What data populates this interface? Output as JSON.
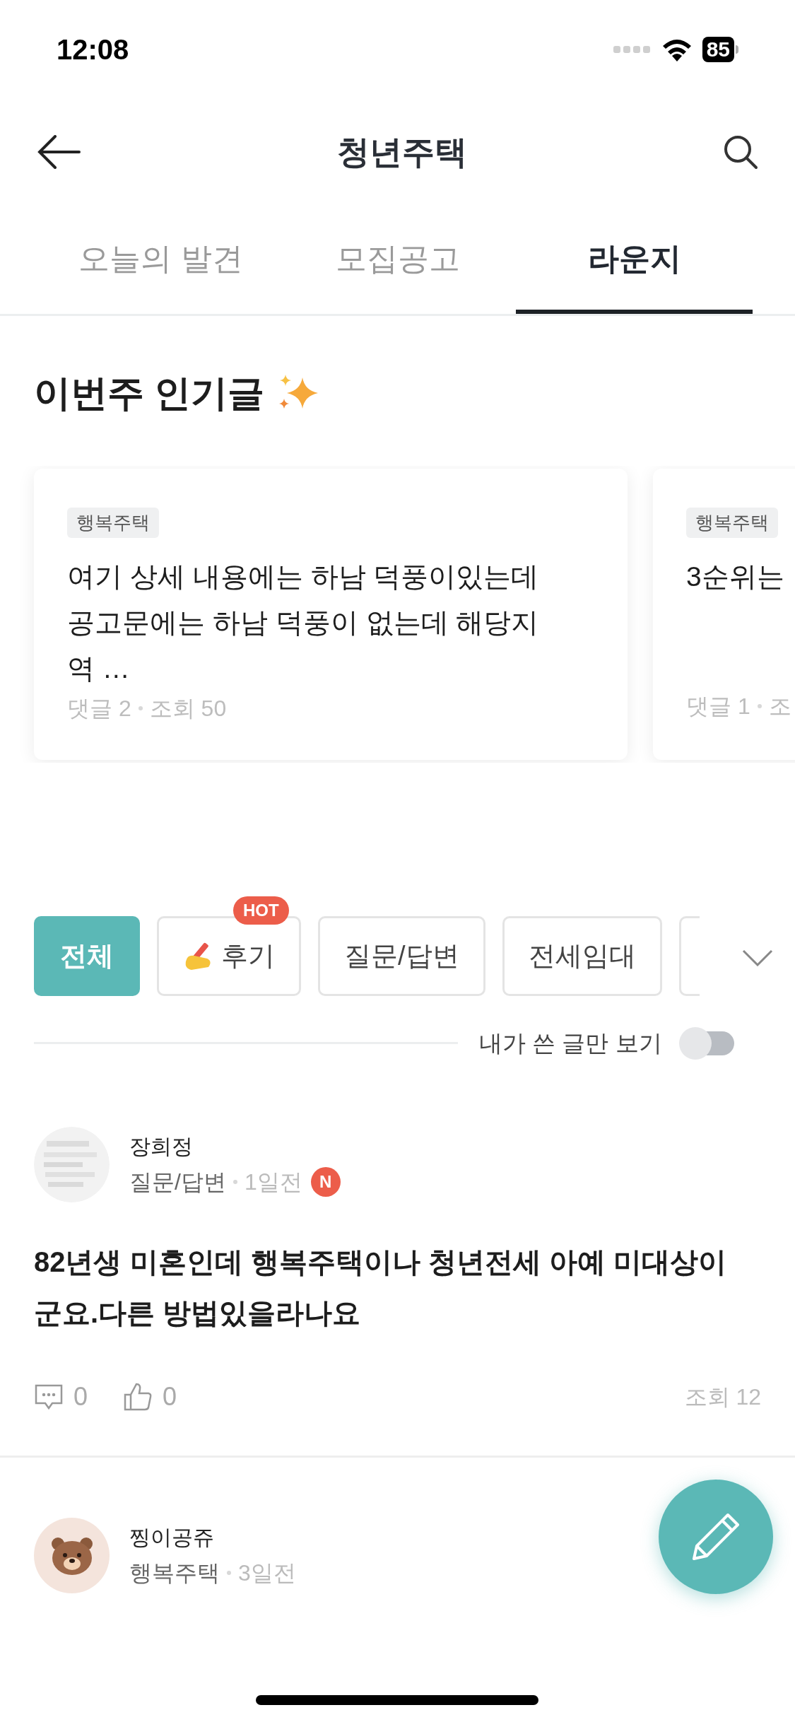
{
  "status_bar": {
    "time": "12:08",
    "battery": "85"
  },
  "header": {
    "title": "청년주택"
  },
  "tabs": [
    {
      "label": "오늘의 발견",
      "selected": false
    },
    {
      "label": "모집공고",
      "selected": false
    },
    {
      "label": "라운지",
      "selected": true
    }
  ],
  "popular": {
    "title": "이번주 인기글",
    "cards": [
      {
        "tag": "행복주택",
        "text": "여기 상세 내용에는 하남 덕풍이있는데 공고문에는 하남 덕풍이 없는데 해당지역 …",
        "comments": "댓글 2",
        "views": "조회 50"
      },
      {
        "tag": "행복주택",
        "text": "3순위는",
        "comments": "댓글 1",
        "views": "조"
      }
    ]
  },
  "categories": [
    {
      "label": "전체",
      "selected": true,
      "kind": "plain"
    },
    {
      "label": "후기",
      "selected": false,
      "kind": "emoji",
      "badge": "HOT"
    },
    {
      "label": "질문/답변",
      "selected": false,
      "kind": "plain"
    },
    {
      "label": "전세임대",
      "selected": false,
      "kind": "plain"
    },
    {
      "selected": false,
      "kind": "cut"
    }
  ],
  "my_posts_toggle": {
    "label": "내가 쓴 글만 보기",
    "on": false
  },
  "posts": [
    {
      "author": "장희정",
      "category": "질문/답변",
      "time": "1일전",
      "new_badge": "N",
      "kind": "picture",
      "title": "82년생 미혼인데 행복주택이나 청년전세 아예 미대상이 군요.다른 방법있을라나요",
      "comments": "0",
      "likes": "0",
      "views": "조회 12"
    },
    {
      "author": "찡이공쥬",
      "category": "행복주택",
      "time": "3일전",
      "kind": "bear"
    }
  ]
}
